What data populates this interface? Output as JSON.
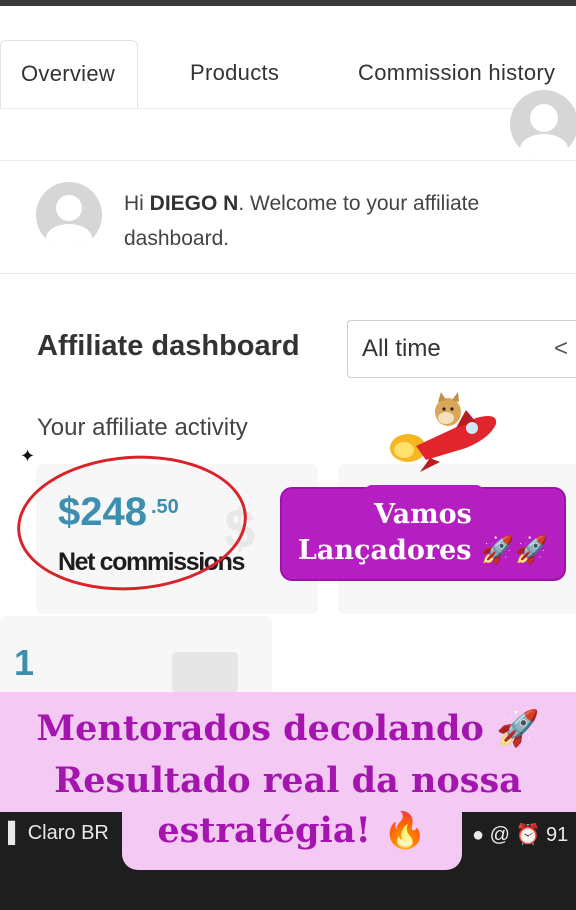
{
  "tabs": [
    {
      "label": "Overview"
    },
    {
      "label": "Products"
    },
    {
      "label": "Commission history"
    }
  ],
  "welcome": {
    "greeting": "Hi ",
    "name": "DIEGO N",
    "suffix": ". Welcome to your affiliate dashboard."
  },
  "dashboard": {
    "title": "Affiliate dashboard",
    "range": "All time",
    "activity_label": "Your affiliate activity",
    "net_amount": "$248",
    "net_cents": ".50",
    "net_label": "Net commissions",
    "second_count": "1"
  },
  "overlays": {
    "sticker_line1": "Vamos",
    "sticker_line2": "Lançadores 🚀🚀",
    "banner_line1": "Mentorados decolando 🚀",
    "banner_line2": "Resultado real da nossa",
    "banner_line3": "estratégia! 🔥"
  },
  "status_bar": {
    "carrier": "Claro BR",
    "battery": "91"
  },
  "colors": {
    "accent_blue": "#3d8fb0",
    "sticker_purple": "#b51ec0",
    "banner_pink": "#f4c9f4",
    "banner_text": "#a415b0",
    "circle_red": "#d9222a"
  }
}
